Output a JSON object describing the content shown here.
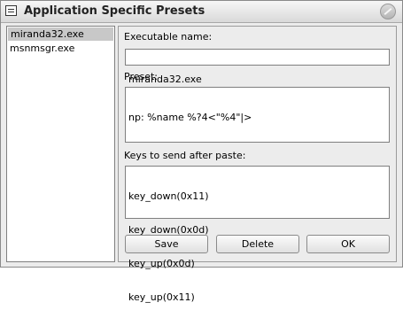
{
  "window": {
    "title": "Application Specific Presets"
  },
  "list": {
    "items": [
      {
        "label": "miranda32.exe",
        "selected": true
      },
      {
        "label": "msnmsgr.exe",
        "selected": false
      }
    ]
  },
  "form": {
    "executable_label": "Executable name:",
    "executable_value": "miranda32.exe",
    "preset_label": "Preset:",
    "preset_value": "np: %name %?4<\"%4\"|>",
    "keys_label": "Keys to send after paste:",
    "keys_lines": [
      "key_down(0x11)",
      "key_down(0x0d)",
      "key_up(0x0d)",
      "key_up(0x11)"
    ]
  },
  "buttons": {
    "save": "Save",
    "delete": "Delete",
    "ok": "OK"
  }
}
